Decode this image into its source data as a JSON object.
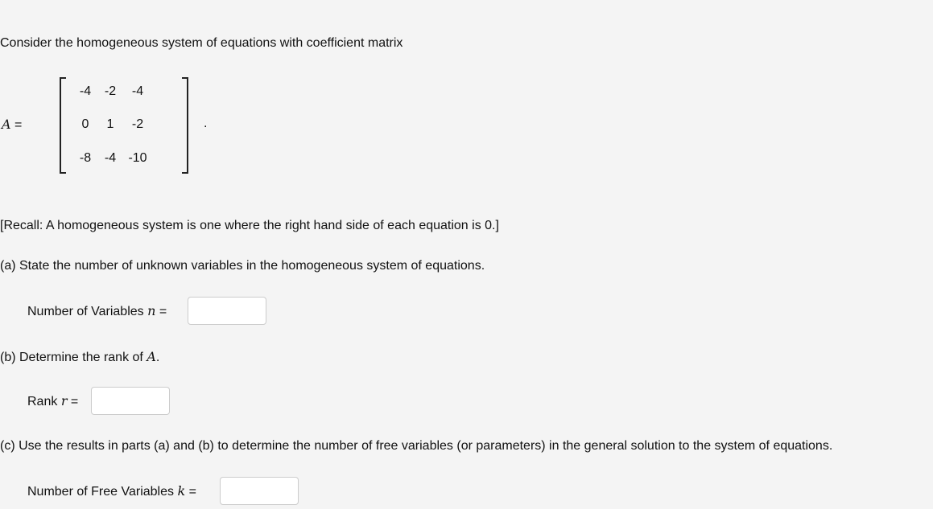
{
  "intro": "Consider the homogeneous system of equations with coefficient matrix",
  "matrix": {
    "name": "A",
    "equals": "=",
    "rows": [
      [
        "-4",
        "-2",
        "-4"
      ],
      [
        "0",
        "1",
        "-2"
      ],
      [
        "-8",
        "-4",
        "-10"
      ]
    ],
    "trailing": "."
  },
  "recall": "[Recall: A homogeneous system is one where the right hand side of each equation is 0.]",
  "parts": {
    "a": {
      "question": "(a) State the number of unknown variables in the homogeneous system of equations.",
      "label": "Number of Variables",
      "var": "n",
      "equals": "=",
      "value": ""
    },
    "b": {
      "question_prefix": "(b) Determine the rank of",
      "question_var": "A",
      "question_suffix": ".",
      "label": "Rank",
      "var": "r",
      "equals": "=",
      "value": ""
    },
    "c": {
      "question": "(c) Use the results in parts (a) and (b) to determine the number of free variables (or parameters) in the general solution to the system of equations.",
      "label": "Number of Free Variables",
      "var": "k",
      "equals": "=",
      "value": ""
    }
  }
}
